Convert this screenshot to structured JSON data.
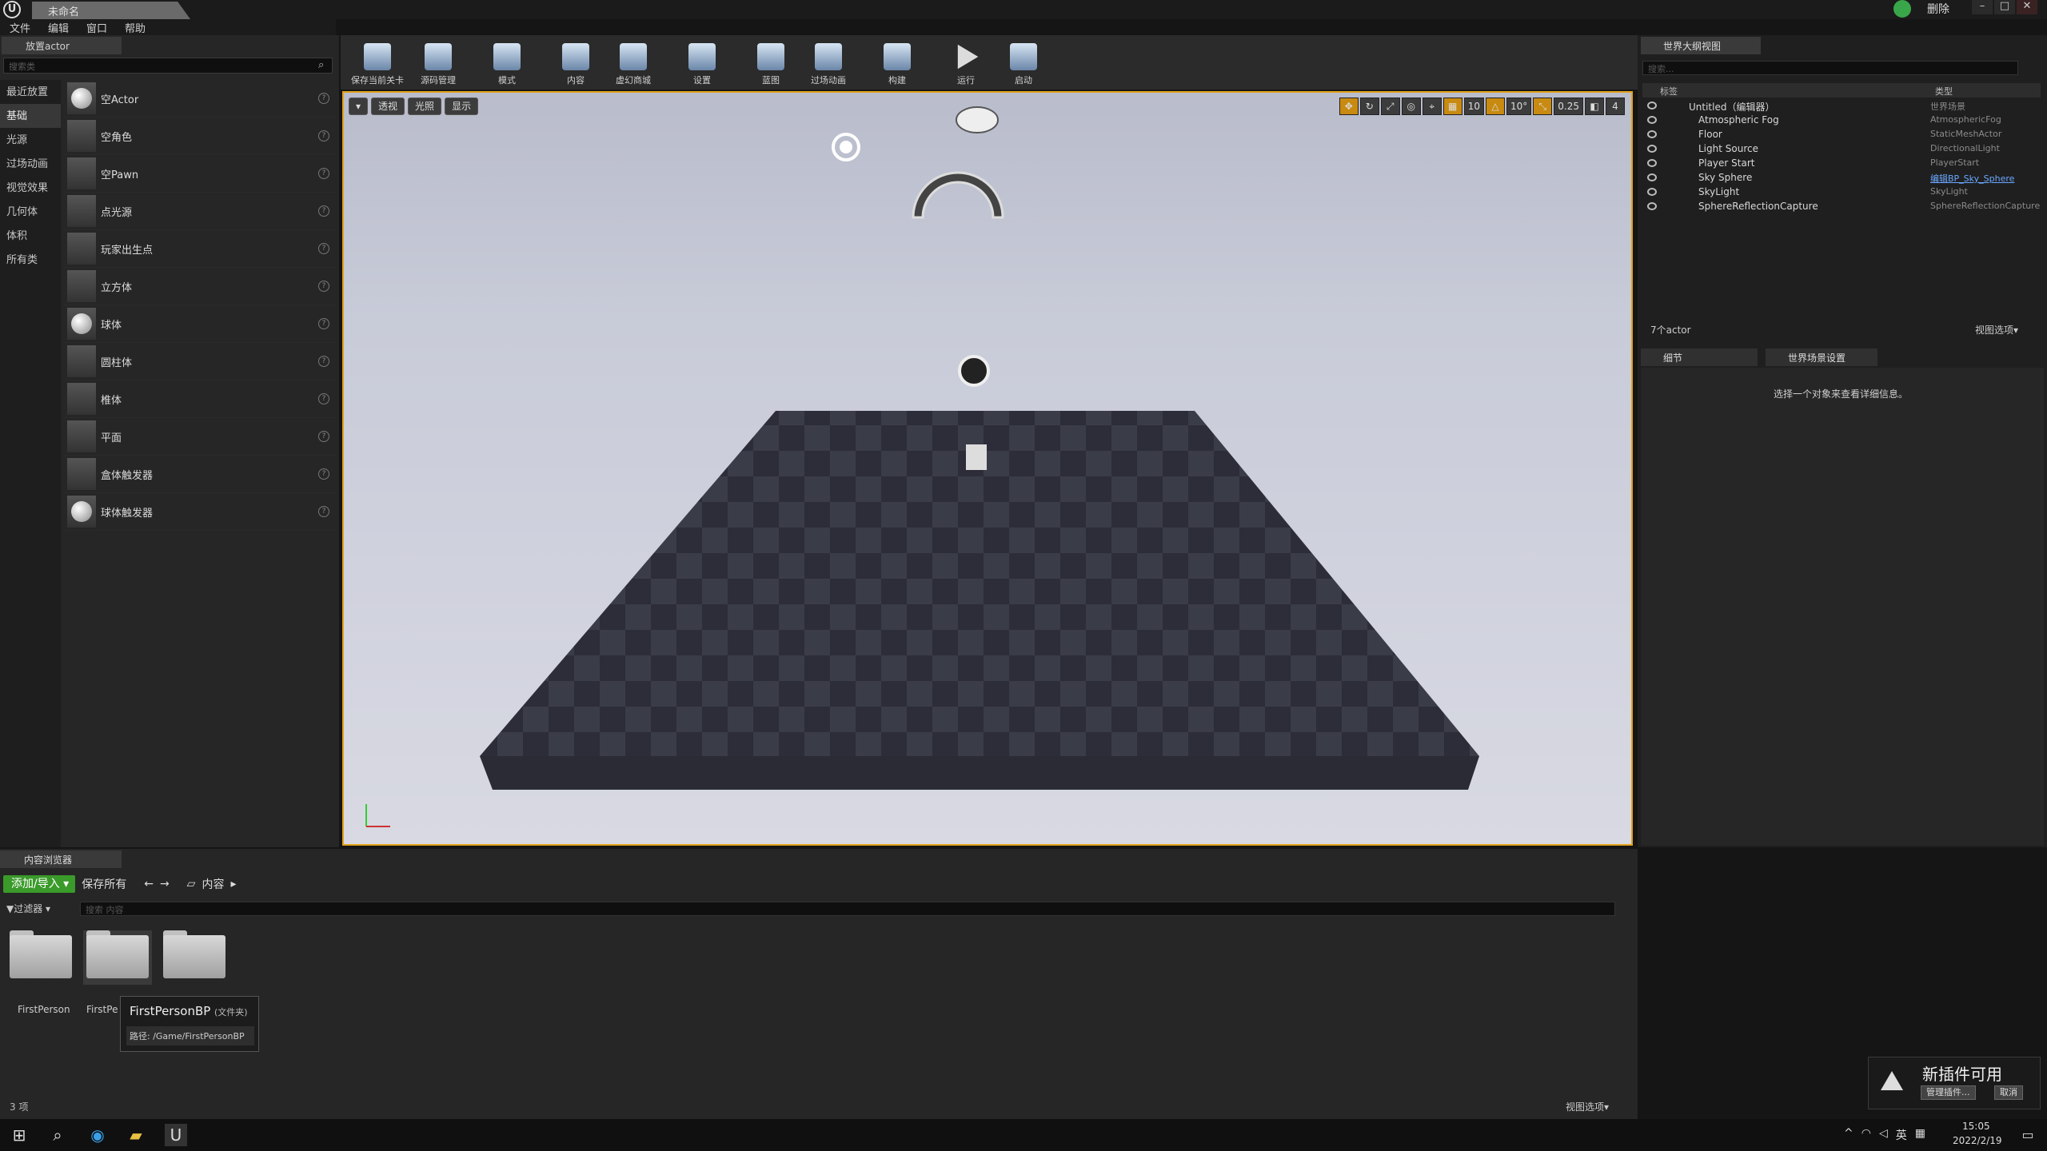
{
  "window": {
    "title": "未命名",
    "min": "–",
    "max": "□",
    "close": "✕",
    "delete_label": "删除"
  },
  "menu": [
    "文件",
    "编辑",
    "窗口",
    "帮助"
  ],
  "place_actor": {
    "tab": "放置actor",
    "search_placeholder": "搜索类",
    "categories": [
      "最近放置",
      "基础",
      "光源",
      "过场动画",
      "视觉效果",
      "几何体",
      "体积",
      "所有类"
    ],
    "items": [
      "空Actor",
      "空角色",
      "空Pawn",
      "点光源",
      "玩家出生点",
      "立方体",
      "球体",
      "圆柱体",
      "椎体",
      "平面",
      "盒体触发器",
      "球体触发器"
    ]
  },
  "toolbar": [
    "保存当前关卡",
    "源码管理",
    "模式",
    "内容",
    "虚幻商城",
    "设置",
    "蓝图",
    "过场动画",
    "构建",
    "运行",
    "启动"
  ],
  "viewport": {
    "left_buttons": [
      "▾",
      "透视",
      "光照",
      "显示"
    ],
    "right_buttons": [
      "10",
      "10°",
      "0.25",
      "4"
    ]
  },
  "outliner": {
    "tab": "世界大纲视图",
    "search_placeholder": "搜索...",
    "col_label": "标签",
    "col_type": "类型",
    "rows": [
      {
        "name": "Untitled（编辑器）",
        "type": "世界场景"
      },
      {
        "name": "Atmospheric Fog",
        "type": "AtmosphericFog"
      },
      {
        "name": "Floor",
        "type": "StaticMeshActor"
      },
      {
        "name": "Light Source",
        "type": "DirectionalLight"
      },
      {
        "name": "Player Start",
        "type": "PlayerStart"
      },
      {
        "name": "Sky Sphere",
        "type": "编辑BP_Sky_Sphere"
      },
      {
        "name": "SkyLight",
        "type": "SkyLight"
      },
      {
        "name": "SphereReflectionCapture",
        "type": "SphereReflectionCapture"
      }
    ],
    "actor_count": "7个actor",
    "view_options": "视图选项▾"
  },
  "details": {
    "tab1": "细节",
    "tab2": "世界场景设置",
    "empty_msg": "选择一个对象来查看详细信息。"
  },
  "content_browser": {
    "tab": "内容浏览器",
    "add_import": "添加/导入 ▾",
    "save_all": "保存所有",
    "path": "内容",
    "filter": "▼过滤器 ▾",
    "search_placeholder": "搜索 内容",
    "folders": [
      "FirstPerson",
      "FirstPe",
      ""
    ],
    "tooltip_title": "FirstPersonBP",
    "tooltip_type": "(文件夹)",
    "tooltip_path": "路径: /Game/FirstPersonBP",
    "count": "3 项",
    "view_options": "视图选项▾"
  },
  "notification": {
    "title": "新插件可用",
    "manage": "管理插件...",
    "cancel": "取消"
  },
  "taskbar": {
    "time": "15:05",
    "date": "2022/2/19",
    "lang": "英"
  }
}
